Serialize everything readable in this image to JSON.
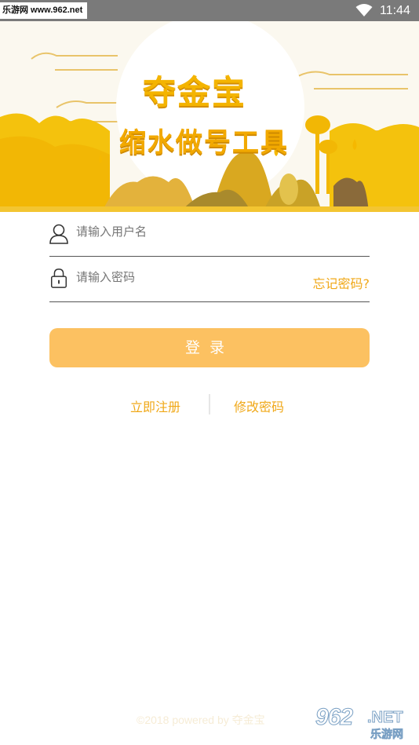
{
  "status_bar": {
    "watermark": "乐游网 www.962.net",
    "time": "11:44",
    "icons": [
      "wifi-icon"
    ]
  },
  "banner": {
    "title_line1": "夺金宝",
    "title_line2": "缩水做号工具",
    "colors": {
      "gold": "#f4b400",
      "orange": "#f2a900",
      "dark_gold": "#c9a227"
    }
  },
  "login_form": {
    "username": {
      "placeholder": "请输入用户名",
      "value": "",
      "icon": "user-icon"
    },
    "password": {
      "placeholder": "请输入密码",
      "value": "",
      "icon": "lock-icon"
    },
    "forgot_label": "忘记密码?",
    "login_label": "登录"
  },
  "links": {
    "register_label": "立即注册",
    "change_password_label": "修改密码"
  },
  "footer": {
    "copyright": "©2018 powered by 夺金宝",
    "watermark_num": "962",
    "watermark_net": ".NET",
    "watermark_cn": "乐游网"
  },
  "theme": {
    "accent": "#f0a818",
    "button_bg": "#fcc161",
    "status_bar_bg": "#7a7a7a"
  }
}
